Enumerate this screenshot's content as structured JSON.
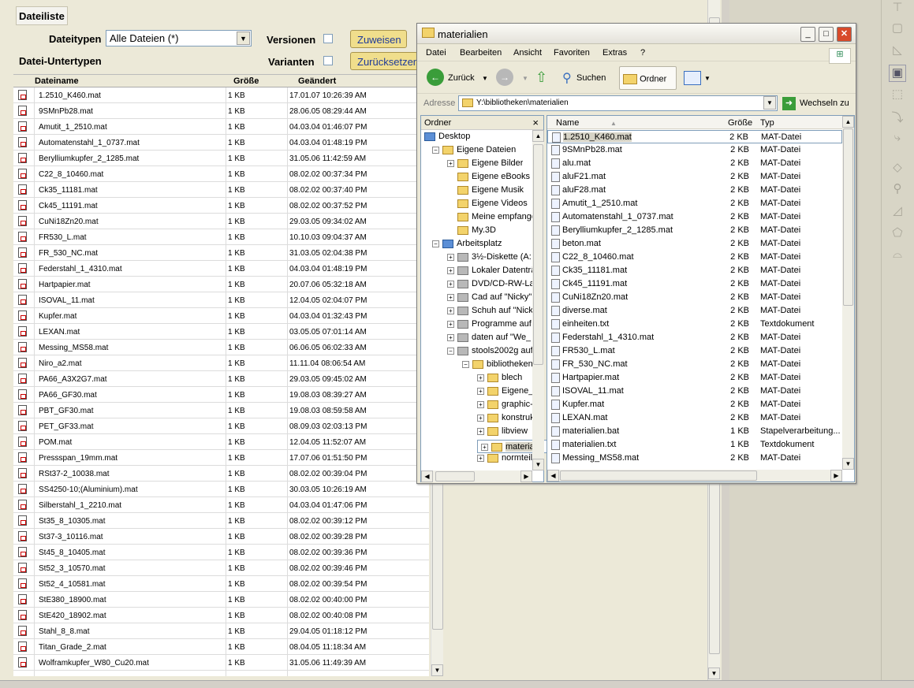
{
  "left_panel": {
    "title": "Dateiliste",
    "filetypes_label": "Dateitypen",
    "filetypes_value": "Alle Dateien (*)",
    "subtypes_label": "Datei-Untertypen",
    "versions_label": "Versionen",
    "variants_label": "Varianten",
    "assign_button": "Zuweisen",
    "reset_button": "Zurücksetzen",
    "columns": [
      "Dateiname",
      "Größe",
      "Geändert"
    ],
    "files": [
      [
        "1.2510_K460.mat",
        "1 KB",
        "17.01.07 10:26:39 AM"
      ],
      [
        "9SMnPb28.mat",
        "1 KB",
        "28.06.05 08:29:44 AM"
      ],
      [
        "Amutit_1_2510.mat",
        "1 KB",
        "04.03.04 01:46:07 PM"
      ],
      [
        "Automatenstahl_1_0737.mat",
        "1 KB",
        "04.03.04 01:48:19 PM"
      ],
      [
        "Berylliumkupfer_2_1285.mat",
        "1 KB",
        "31.05.06 11:42:59 AM"
      ],
      [
        "C22_8_10460.mat",
        "1 KB",
        "08.02.02 00:37:34 PM"
      ],
      [
        "Ck35_11181.mat",
        "1 KB",
        "08.02.02 00:37:40 PM"
      ],
      [
        "Ck45_11191.mat",
        "1 KB",
        "08.02.02 00:37:52 PM"
      ],
      [
        "CuNi18Zn20.mat",
        "1 KB",
        "29.03.05 09:34:02 AM"
      ],
      [
        "FR530_L.mat",
        "1 KB",
        "10.10.03 09:04:37 AM"
      ],
      [
        "FR_530_NC.mat",
        "1 KB",
        "31.03.05 02:04:38 PM"
      ],
      [
        "Federstahl_1_4310.mat",
        "1 KB",
        "04.03.04 01:48:19 PM"
      ],
      [
        "Hartpapier.mat",
        "1 KB",
        "20.07.06 05:32:18 AM"
      ],
      [
        "ISOVAL_11.mat",
        "1 KB",
        "12.04.05 02:04:07 PM"
      ],
      [
        "Kupfer.mat",
        "1 KB",
        "04.03.04 01:32:43 PM"
      ],
      [
        "LEXAN.mat",
        "1 KB",
        "03.05.05 07:01:14 AM"
      ],
      [
        "Messing_MS58.mat",
        "1 KB",
        "06.06.05 06:02:33 AM"
      ],
      [
        "Niro_a2.mat",
        "1 KB",
        "11.11.04 08:06:54 AM"
      ],
      [
        "PA66_A3X2G7.mat",
        "1 KB",
        "29.03.05 09:45:02 AM"
      ],
      [
        "PA66_GF30.mat",
        "1 KB",
        "19.08.03 08:39:27 AM"
      ],
      [
        "PBT_GF30.mat",
        "1 KB",
        "19.08.03 08:59:58 AM"
      ],
      [
        "PET_GF33.mat",
        "1 KB",
        "08.09.03 02:03:13 PM"
      ],
      [
        "POM.mat",
        "1 KB",
        "12.04.05 11:52:07 AM"
      ],
      [
        "Pressspan_19mm.mat",
        "1 KB",
        "17.07.06 01:51:50 PM"
      ],
      [
        "RSt37-2_10038.mat",
        "1 KB",
        "08.02.02 00:39:04 PM"
      ],
      [
        "SS4250-10;(Aluminium).mat",
        "1 KB",
        "30.03.05 10:26:19 AM"
      ],
      [
        "Silberstahl_1_2210.mat",
        "1 KB",
        "04.03.04 01:47:06 PM"
      ],
      [
        "St35_8_10305.mat",
        "1 KB",
        "08.02.02 00:39:12 PM"
      ],
      [
        "St37-3_10116.mat",
        "1 KB",
        "08.02.02 00:39:28 PM"
      ],
      [
        "St45_8_10405.mat",
        "1 KB",
        "08.02.02 00:39:36 PM"
      ],
      [
        "St52_3_10570.mat",
        "1 KB",
        "08.02.02 00:39:46 PM"
      ],
      [
        "St52_4_10581.mat",
        "1 KB",
        "08.02.02 00:39:54 PM"
      ],
      [
        "StE380_18900.mat",
        "1 KB",
        "08.02.02 00:40:00 PM"
      ],
      [
        "StE420_18902.mat",
        "1 KB",
        "08.02.02 00:40:08 PM"
      ],
      [
        "Stahl_8_8.mat",
        "1 KB",
        "29.04.05 01:18:12 PM"
      ],
      [
        "Titan_Grade_2.mat",
        "1 KB",
        "08.04.05 11:18:34 AM"
      ],
      [
        "Wolframkupfer_W80_Cu20.mat",
        "1 KB",
        "31.05.06 11:49:39 AM"
      ]
    ]
  },
  "explorer": {
    "title": "materialien",
    "menu": [
      "Datei",
      "Bearbeiten",
      "Ansicht",
      "Favoriten",
      "Extras",
      "?"
    ],
    "back_label": "Zurück",
    "search_label": "Suchen",
    "folders_label": "Ordner",
    "address_label": "Adresse",
    "address_value": "Y:\\bibliotheken\\materialien",
    "go_label": "Wechseln zu",
    "tree_header": "Ordner",
    "tree_close": "×",
    "tree": [
      [
        "Desktop",
        0,
        "",
        "dk"
      ],
      [
        "Eigene Dateien",
        1,
        "−",
        "fo"
      ],
      [
        "Eigene Bilder",
        2,
        "+",
        "fo"
      ],
      [
        "Eigene eBooks",
        2,
        "",
        "fo"
      ],
      [
        "Eigene Musik",
        2,
        "",
        "fo"
      ],
      [
        "Eigene Videos",
        2,
        "",
        "fo"
      ],
      [
        "Meine empfange",
        2,
        "",
        "fo"
      ],
      [
        "My.3D",
        2,
        "",
        "fo"
      ],
      [
        "Arbeitsplatz",
        1,
        "−",
        "dk"
      ],
      [
        "3½-Diskette (A:",
        2,
        "+",
        "dv"
      ],
      [
        "Lokaler Datenträ",
        2,
        "+",
        "dv"
      ],
      [
        "DVD/CD-RW-Lau",
        2,
        "+",
        "dv"
      ],
      [
        "Cad auf \"Nicky\"",
        2,
        "+",
        "dv"
      ],
      [
        "Schuh auf \"Nicky",
        2,
        "+",
        "dv"
      ],
      [
        "Programme auf",
        2,
        "+",
        "dv"
      ],
      [
        "daten auf \"We_",
        2,
        "+",
        "dv"
      ],
      [
        "stools2002g auf",
        2,
        "−",
        "dv"
      ],
      [
        "bibliotheken",
        3,
        "−",
        "fo"
      ],
      [
        "blech",
        4,
        "+",
        "fo"
      ],
      [
        "Eigene_",
        4,
        "+",
        "fo"
      ],
      [
        "graphic-",
        4,
        "+",
        "fo"
      ],
      [
        "konstruk",
        4,
        "+",
        "fo"
      ],
      [
        "libview",
        4,
        "+",
        "fo"
      ],
      [
        "materiali",
        4,
        "+",
        "fo"
      ],
      [
        "normteil",
        4,
        "+",
        "fo"
      ]
    ],
    "list_columns": [
      "Name",
      "Größe",
      "Typ"
    ],
    "list": [
      [
        "1.2510_K460.mat",
        "2 KB",
        "MAT-Datei"
      ],
      [
        "9SMnPb28.mat",
        "2 KB",
        "MAT-Datei"
      ],
      [
        "alu.mat",
        "2 KB",
        "MAT-Datei"
      ],
      [
        "aluF21.mat",
        "2 KB",
        "MAT-Datei"
      ],
      [
        "aluF28.mat",
        "2 KB",
        "MAT-Datei"
      ],
      [
        "Amutit_1_2510.mat",
        "2 KB",
        "MAT-Datei"
      ],
      [
        "Automatenstahl_1_0737.mat",
        "2 KB",
        "MAT-Datei"
      ],
      [
        "Berylliumkupfer_2_1285.mat",
        "2 KB",
        "MAT-Datei"
      ],
      [
        "beton.mat",
        "2 KB",
        "MAT-Datei"
      ],
      [
        "C22_8_10460.mat",
        "2 KB",
        "MAT-Datei"
      ],
      [
        "Ck35_11181.mat",
        "2 KB",
        "MAT-Datei"
      ],
      [
        "Ck45_11191.mat",
        "2 KB",
        "MAT-Datei"
      ],
      [
        "CuNi18Zn20.mat",
        "2 KB",
        "MAT-Datei"
      ],
      [
        "diverse.mat",
        "2 KB",
        "MAT-Datei"
      ],
      [
        "einheiten.txt",
        "2 KB",
        "Textdokument"
      ],
      [
        "Federstahl_1_4310.mat",
        "2 KB",
        "MAT-Datei"
      ],
      [
        "FR530_L.mat",
        "2 KB",
        "MAT-Datei"
      ],
      [
        "FR_530_NC.mat",
        "2 KB",
        "MAT-Datei"
      ],
      [
        "Hartpapier.mat",
        "2 KB",
        "MAT-Datei"
      ],
      [
        "ISOVAL_11.mat",
        "2 KB",
        "MAT-Datei"
      ],
      [
        "Kupfer.mat",
        "2 KB",
        "MAT-Datei"
      ],
      [
        "LEXAN.mat",
        "2 KB",
        "MAT-Datei"
      ],
      [
        "materialien.bat",
        "1 KB",
        "Stapelverarbeitung..."
      ],
      [
        "materialien.txt",
        "1 KB",
        "Textdokument"
      ],
      [
        "Messing_MS58.mat",
        "2 KB",
        "MAT-Datei"
      ]
    ]
  }
}
